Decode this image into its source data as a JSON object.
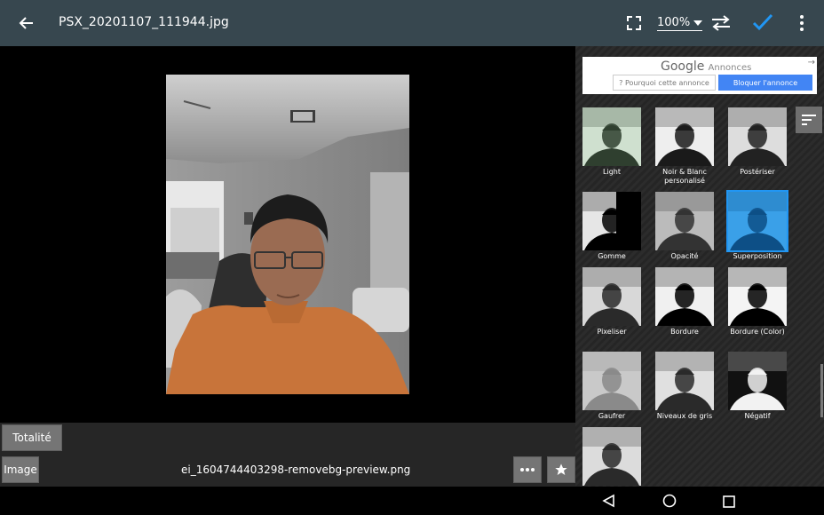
{
  "appbar": {
    "back_icon": "arrow-left-icon",
    "title": "PSX_20201107_111944.jpg",
    "zoom": "100%",
    "fit_icon": "fullscreen-icon",
    "swap_icon": "swap-horizontal-icon",
    "confirm_icon": "check-icon",
    "menu_icon": "more-vert-icon"
  },
  "bottom": {
    "totality_label": "Totalité",
    "image_label": "Image",
    "layer_name": "ei_1604744403298-removebg-preview.png",
    "more_icon": "more-horiz-icon",
    "favorite_icon": "star-icon"
  },
  "ad": {
    "brand": "Google",
    "brand_suffix": "Annonces",
    "why_label": "? Pourquoi cette annonce",
    "block_label": "Bloquer l'annonce"
  },
  "effects": [
    {
      "label": "Light"
    },
    {
      "label": "Noir & Blanc personalisé"
    },
    {
      "label": "Postériser"
    },
    {
      "label": "Gomme"
    },
    {
      "label": "Opacité"
    },
    {
      "label": "Superposition",
      "selected": true
    },
    {
      "label": "Pixeliser"
    },
    {
      "label": "Bordure"
    },
    {
      "label": "Bordure (Color)"
    },
    {
      "label": "Gaufrer"
    },
    {
      "label": "Niveaux de gris"
    },
    {
      "label": "Négatif"
    },
    {
      "label": ""
    }
  ],
  "colors": {
    "appbar": "#37474f",
    "accent": "#2196f3",
    "shirt": "#c8743a"
  }
}
